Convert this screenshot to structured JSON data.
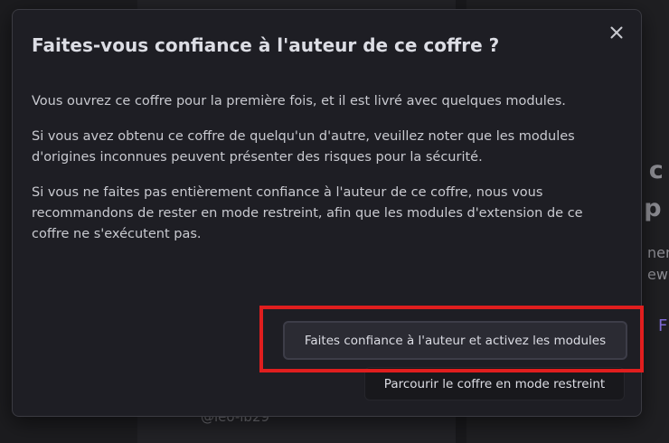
{
  "background": {
    "title_text": "e c\nt p",
    "subtitle_text": "nen\new)",
    "link_text": "F",
    "handle_text": "@leo-lb29"
  },
  "dialog": {
    "title": "Faites-vous confiance à l'auteur de ce coffre ?",
    "close_icon": "close-icon",
    "paragraphs": [
      "Vous ouvrez ce coffre pour la première fois, et il est livré avec quelques modules.",
      "Si vous avez obtenu ce coffre de quelqu'un d'autre, veuillez noter que les modules d'origines inconnues peuvent présenter des risques pour la sécurité.",
      "Si vous ne faites pas entièrement confiance à l'auteur de ce coffre, nous vous recommandons de rester en mode restreint, afin que les modules d'extension de ce coffre ne s'exécutent pas."
    ],
    "trust_button_label": "Faites confiance à l'auteur et activez les modules",
    "restricted_button_label": "Parcourir le coffre en mode restreint"
  },
  "colors": {
    "highlight": "#e01e1e",
    "dialog_background": "#1e1e24",
    "accent": "#7f6bd6"
  }
}
